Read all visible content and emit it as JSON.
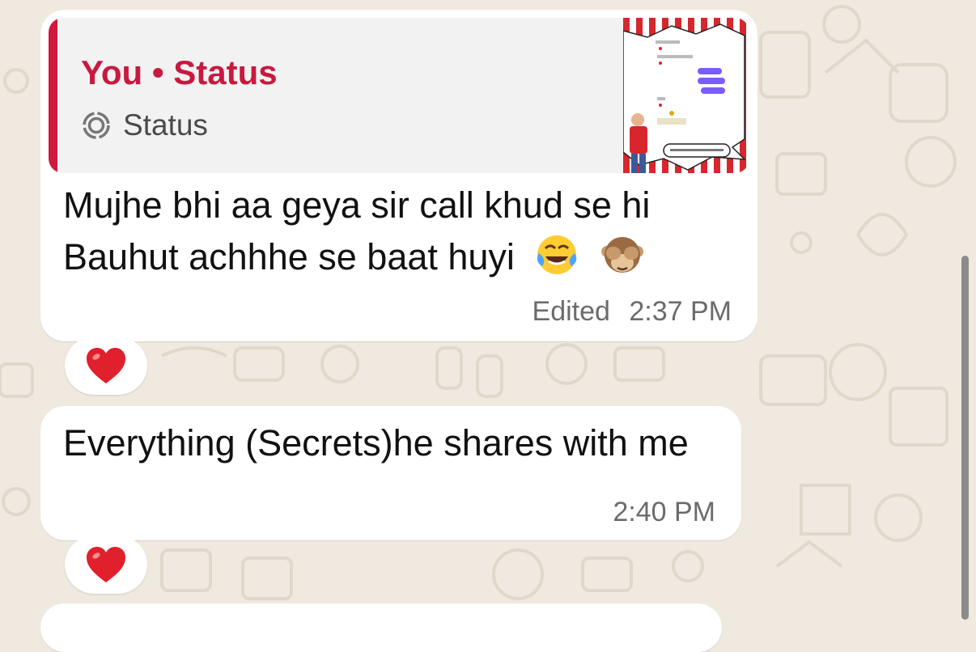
{
  "colors": {
    "background": "#efe9df",
    "bubble": "#ffffff",
    "quote_accent": "#d0193d",
    "quote_title": "#c8193f",
    "reaction_heart": "#e0202c"
  },
  "messages": [
    {
      "quote": {
        "title": "You • Status",
        "subtitle": "Status",
        "icon": "status-ring-icon"
      },
      "text": "Mujhe bhi aa geya sir call khud se hi Bauhut achhhe se baat huyi",
      "emojis": [
        "laughing-tears-emoji",
        "see-no-evil-monkey-emoji"
      ],
      "edited_label": "Edited",
      "time": "2:37 PM",
      "reaction": "heart-emoji"
    },
    {
      "text": "Everything (Secrets)he shares with me",
      "time": "2:40 PM",
      "reaction": "heart-emoji"
    }
  ]
}
